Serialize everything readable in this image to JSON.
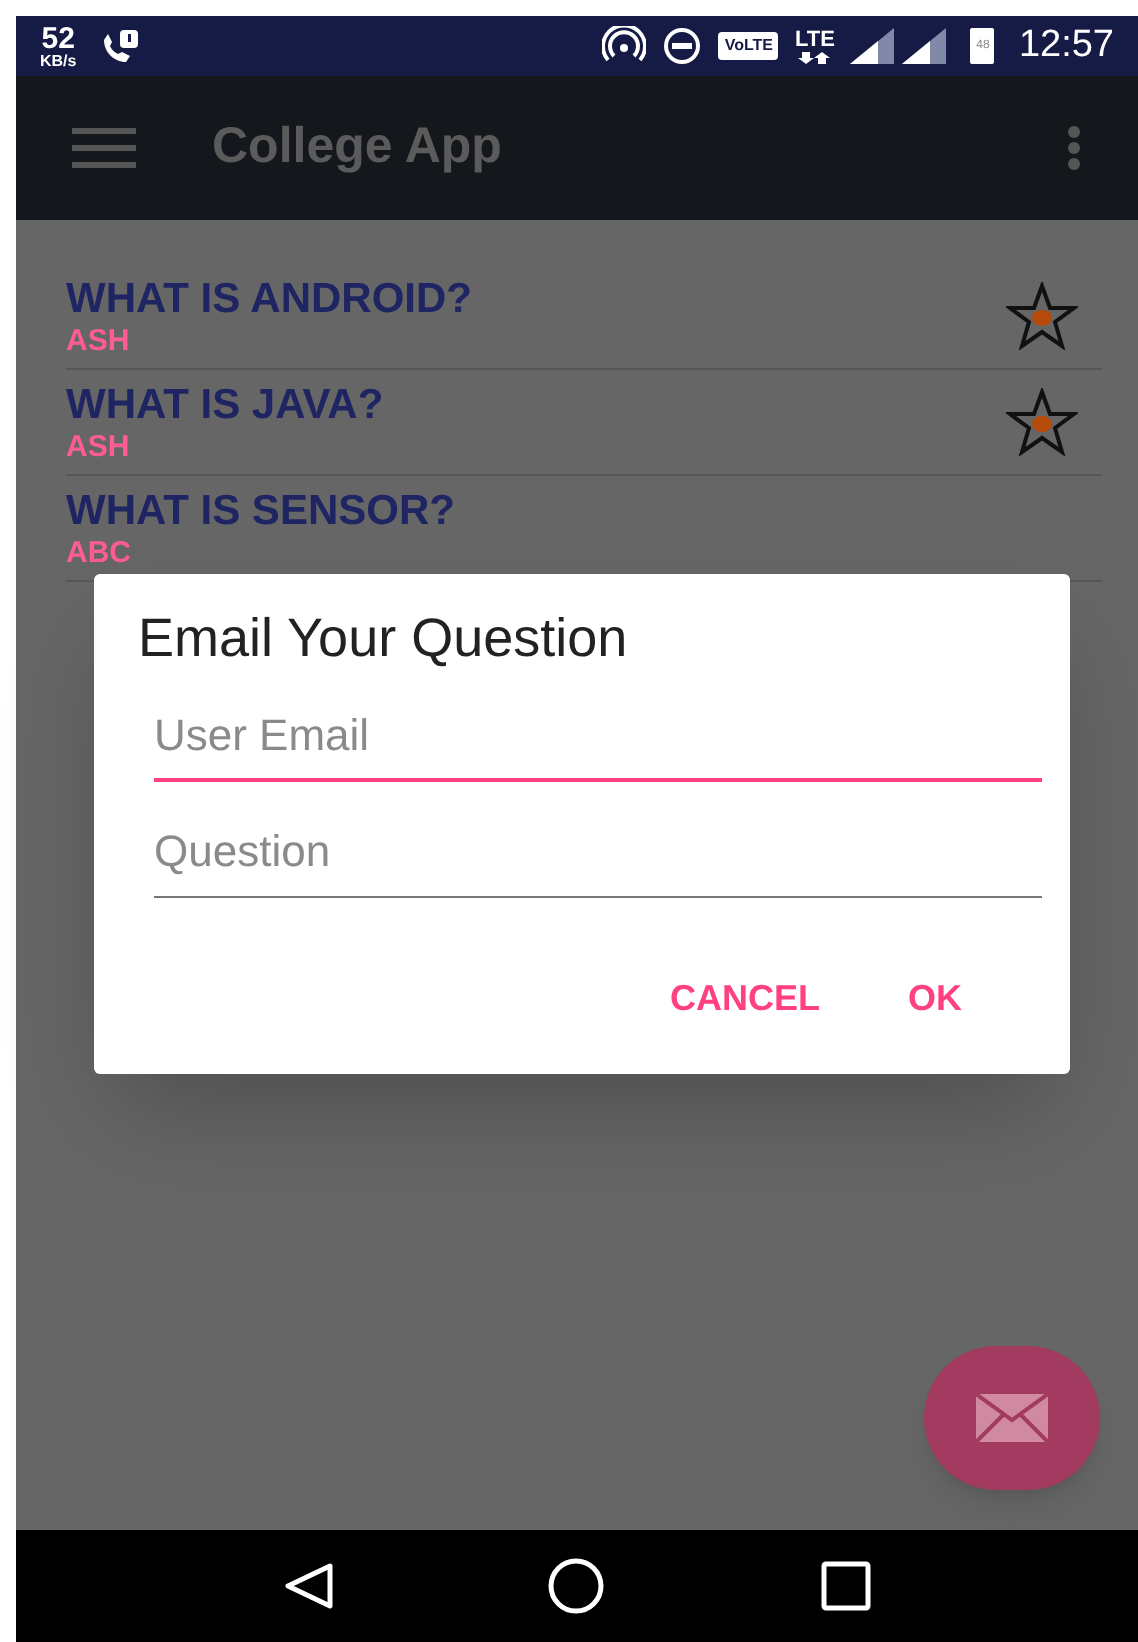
{
  "status_bar": {
    "speed": "52",
    "speed_unit": "KB/s",
    "volte": "VoLTE",
    "network": "LTE",
    "battery": "48",
    "time": "12:57"
  },
  "toolbar": {
    "title": "College App"
  },
  "questions": [
    {
      "title": "WHAT IS ANDROID?",
      "author": "ASH",
      "starred": true
    },
    {
      "title": "WHAT IS JAVA?",
      "author": "ASH",
      "starred": true
    },
    {
      "title": "WHAT IS SENSOR?",
      "author": "ABC",
      "starred": false
    }
  ],
  "dialog": {
    "title": "Email Your Question",
    "fields": [
      {
        "placeholder": "User Email",
        "focused": true
      },
      {
        "placeholder": "Question",
        "focused": false
      }
    ],
    "buttons": [
      "CANCEL",
      "OK"
    ]
  }
}
